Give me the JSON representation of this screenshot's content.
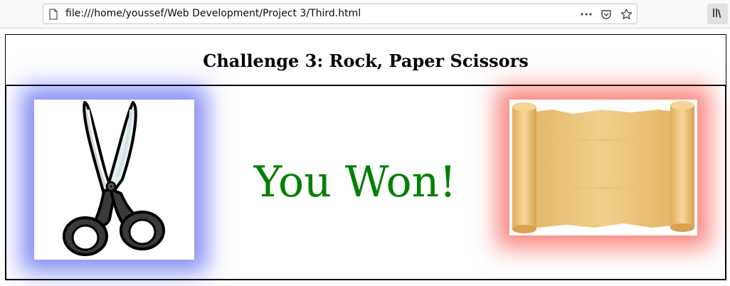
{
  "browser": {
    "url": "file:///home/youssef/Web Development/Project 3/Third.html",
    "icons": [
      "page-icon",
      "more-actions-icon",
      "pocket-icon",
      "bookmark-star-icon",
      "library-icon"
    ]
  },
  "page": {
    "title": "Challenge 3: Rock, Paper Scissors",
    "result_message": "You Won!",
    "result_color": "#008000",
    "human_choice": "scissors",
    "bot_choice": "paper",
    "human_glow_color": "#2532e9",
    "bot_glow_color": "#f32618"
  }
}
